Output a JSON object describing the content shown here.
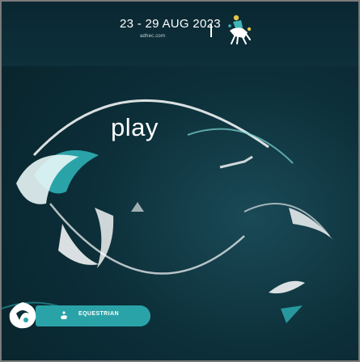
{
  "event": {
    "dates": "23 - 29 AUG 2023",
    "website": "adhec.com"
  },
  "hero": {
    "word": "play"
  },
  "sport_badge": {
    "label": "EQUESTRIAN"
  },
  "colors": {
    "background": "#0c2f39",
    "accent_teal": "#2aa3a8",
    "accent_gold": "#e2c64a",
    "text": "#ffffff"
  },
  "icons": {
    "header": "rider-icon",
    "badge": "equestrian-icon",
    "corner": "logo-swirl-icon"
  }
}
